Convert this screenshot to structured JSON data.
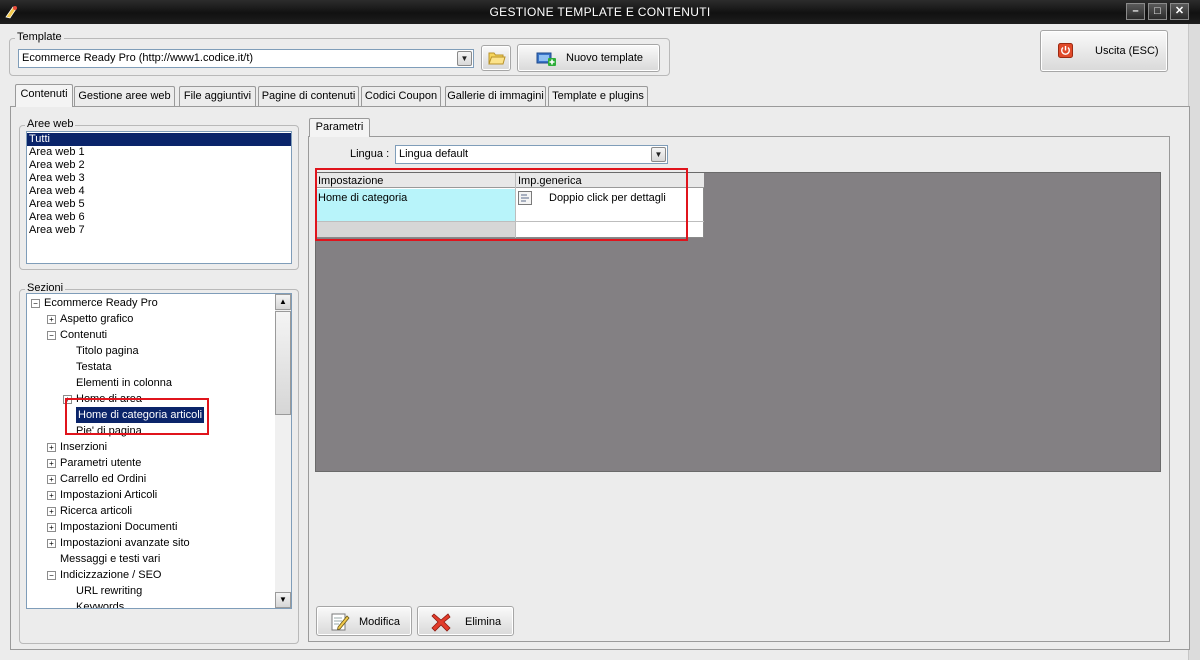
{
  "window": {
    "title": "GESTIONE TEMPLATE E CONTENUTI",
    "minimize": "–",
    "maximize": "□",
    "close": "✕"
  },
  "template": {
    "group_label": "Template",
    "selected": "Ecommerce Ready Pro (http://www1.codice.it/t)",
    "new_button": "Nuovo template"
  },
  "exit_button": "Uscita (ESC)",
  "tabs": [
    {
      "label": "Contenuti",
      "active": true
    },
    {
      "label": "Gestione aree web"
    },
    {
      "label": "File aggiuntivi"
    },
    {
      "label": "Pagine di contenuti"
    },
    {
      "label": "Codici Coupon"
    },
    {
      "label": "Gallerie di immagini"
    },
    {
      "label": "Template e plugins"
    }
  ],
  "aree_web": {
    "label": "Aree web",
    "items": [
      "Tutti",
      "Area web 1",
      "Area web 2",
      "Area web 3",
      "Area web 4",
      "Area web 5",
      "Area web 6",
      "Area web 7"
    ],
    "selected": "Tutti"
  },
  "sezioni": {
    "label": "Sezioni",
    "tree": [
      {
        "label": "Ecommerce Ready Pro",
        "level": 0,
        "exp": "−"
      },
      {
        "label": "Aspetto grafico",
        "level": 1,
        "exp": "+"
      },
      {
        "label": "Contenuti",
        "level": 1,
        "exp": "−"
      },
      {
        "label": "Titolo pagina",
        "level": 2,
        "exp": ""
      },
      {
        "label": "Testata",
        "level": 2,
        "exp": ""
      },
      {
        "label": "Elementi in colonna",
        "level": 2,
        "exp": ""
      },
      {
        "label": "Home di area",
        "level": 2,
        "exp": "+"
      },
      {
        "label": "Home di categoria articoli",
        "level": 2,
        "exp": "",
        "selected": true
      },
      {
        "label": "Pie' di pagina",
        "level": 2,
        "exp": ""
      },
      {
        "label": "Inserzioni",
        "level": 1,
        "exp": "+"
      },
      {
        "label": "Parametri utente",
        "level": 1,
        "exp": "+"
      },
      {
        "label": "Carrello ed Ordini",
        "level": 1,
        "exp": "+"
      },
      {
        "label": "Impostazioni Articoli",
        "level": 1,
        "exp": "+"
      },
      {
        "label": "Ricerca articoli",
        "level": 1,
        "exp": "+"
      },
      {
        "label": "Impostazioni Documenti",
        "level": 1,
        "exp": "+"
      },
      {
        "label": "Impostazioni avanzate sito",
        "level": 1,
        "exp": "+"
      },
      {
        "label": "Messaggi e testi vari",
        "level": 1,
        "exp": ""
      },
      {
        "label": "Indicizzazione / SEO",
        "level": 1,
        "exp": "−"
      },
      {
        "label": "URL rewriting",
        "level": 2,
        "exp": ""
      },
      {
        "label": "Keywords",
        "level": 2,
        "exp": ""
      }
    ]
  },
  "parametri": {
    "tab": "Parametri",
    "lingua_label": "Lingua :",
    "lingua_value": "Lingua default",
    "grid": {
      "headers": [
        "Impostazione",
        "Imp.generica"
      ],
      "rows": [
        {
          "impostazione": "Home di categoria",
          "generica": "Doppio click per dettagli"
        }
      ]
    }
  },
  "buttons": {
    "modifica": "Modifica",
    "elimina": "Elimina"
  },
  "colors": {
    "highlight": "#e0141c",
    "selection": "#0a246a",
    "grid_bg": "#838083",
    "cell_cyan": "#b8f4fa"
  }
}
